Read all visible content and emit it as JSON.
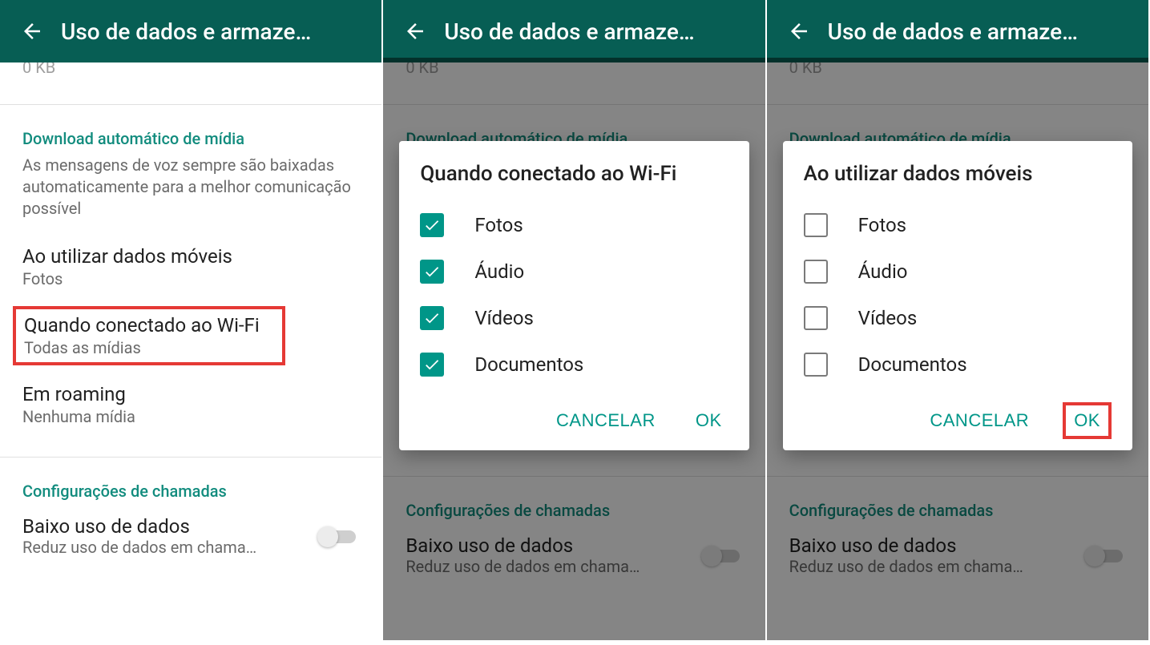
{
  "common": {
    "header_title": "Uso de dados e armaze…",
    "prev_remnant": "0 KB",
    "section_media_title": "Download automático de mídia",
    "section_media_sub": "As mensagens de voz sempre são baixadas automaticamente para a melhor comunicação possível",
    "item_mobile_title": "Ao utilizar dados móveis",
    "item_mobile_sub": "Fotos",
    "item_wifi_title": "Quando conectado ao Wi-Fi",
    "item_wifi_sub": "Todas as mídias",
    "item_roaming_title": "Em roaming",
    "item_roaming_sub": "Nenhuma mídia",
    "section_calls_title": "Configurações de chamadas",
    "low_data_title": "Baixo uso de dados",
    "low_data_sub": "Reduz uso de dados em chama…",
    "cancel_label": "CANCELAR",
    "ok_label": "OK"
  },
  "dialog_wifi": {
    "title": "Quando conectado ao Wi-Fi",
    "options": {
      "photos": "Fotos",
      "audio": "Áudio",
      "videos": "Vídeos",
      "docs": "Documentos"
    }
  },
  "dialog_mobile": {
    "title": "Ao utilizar dados móveis",
    "options": {
      "photos": "Fotos",
      "audio": "Áudio",
      "videos": "Vídeos",
      "docs": "Documentos"
    }
  }
}
